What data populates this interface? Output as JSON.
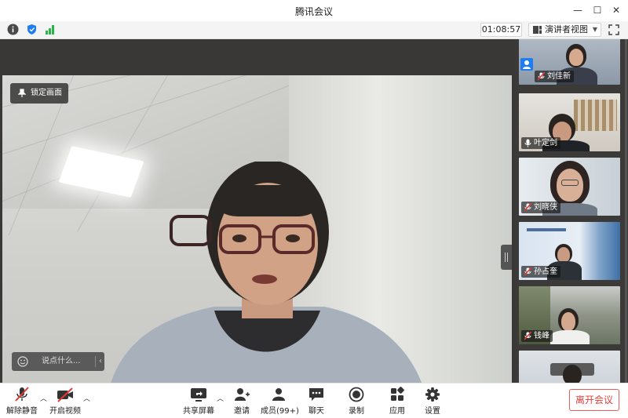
{
  "window": {
    "title": "腾讯会议",
    "minimize_glyph": "—",
    "maximize_glyph": "☐",
    "close_glyph": "✕"
  },
  "toolbar": {
    "info_icon": "info-icon",
    "shield_icon": "shield-icon",
    "signal_icon": "signal-icon",
    "timer": "01:08:57",
    "view_selector": "演讲者视图",
    "fullscreen_icon": "fullscreen-icon"
  },
  "main_video": {
    "lock_label": "锁定画面",
    "chat_placeholder": "说点什么..."
  },
  "participants": [
    {
      "name": "刘佳新"
    },
    {
      "name": "叶定剑"
    },
    {
      "name": "刘晓侠"
    },
    {
      "name": "孙占奎"
    },
    {
      "name": "钱峰"
    },
    {
      "name": ""
    }
  ],
  "controls": {
    "unmute": "解除静音",
    "start_video": "开启视频",
    "share_screen": "共享屏幕",
    "invite": "邀请",
    "members": "成员(99+)",
    "chat": "聊天",
    "record": "录制",
    "apps": "应用",
    "settings": "设置",
    "leave": "离开会议"
  },
  "colors": {
    "accent_blue": "#1e7df2",
    "signal_green": "#2bb44a",
    "mute_red": "#e53935",
    "leave_red": "#e0403b",
    "strip_bg": "#3b3a38"
  }
}
